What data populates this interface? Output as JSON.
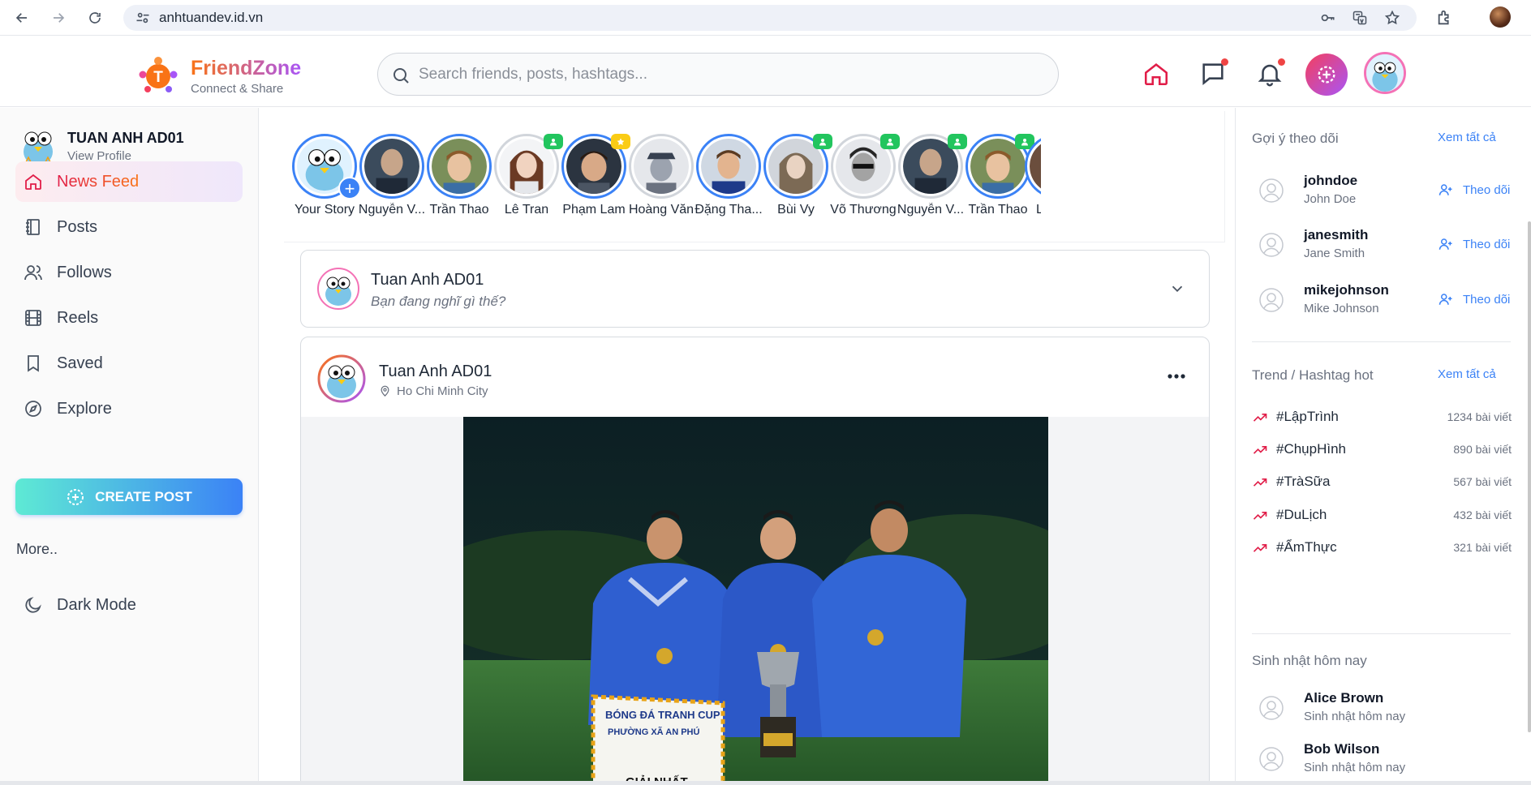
{
  "browser": {
    "url": "anhtuandev.id.vn"
  },
  "header": {
    "brand": "FriendZone",
    "tagline": "Connect & Share",
    "search_placeholder": "Search friends, posts, hashtags..."
  },
  "sidebar": {
    "profile_name": "TUAN ANH AD01",
    "profile_sub": "View Profile",
    "items": [
      {
        "label": "News Feed",
        "icon": "home-icon",
        "active": true
      },
      {
        "label": "Posts",
        "icon": "notebook-icon"
      },
      {
        "label": "Follows",
        "icon": "users-icon"
      },
      {
        "label": "Reels",
        "icon": "film-icon"
      },
      {
        "label": "Saved",
        "icon": "bookmark-icon"
      },
      {
        "label": "Explore",
        "icon": "compass-icon"
      }
    ],
    "create_post": "CREATE POST",
    "more": "More..",
    "dark_mode": "Dark Mode"
  },
  "stories": [
    {
      "name": "Your Story"
    },
    {
      "name": "Nguyễn V..."
    },
    {
      "name": "Trần Thao"
    },
    {
      "name": "Lê Tran"
    },
    {
      "name": "Phạm Lam"
    },
    {
      "name": "Hoàng Văn"
    },
    {
      "name": "Đặng Tha..."
    },
    {
      "name": "Bùi Vy"
    },
    {
      "name": "Võ Thương"
    },
    {
      "name": "Nguyễn V..."
    },
    {
      "name": "Trần Thao"
    },
    {
      "name": "L"
    }
  ],
  "composer": {
    "name": "Tuan Anh AD01",
    "hint": "Bạn đang nghĩ gì thế?"
  },
  "post": {
    "author": "Tuan Anh AD01",
    "location": "Ho Chi Minh City",
    "banner_text": "BÓNG ĐÁ TRANH CUP",
    "banner_text2": "PHƯỜNG XÃ AN PHÚ",
    "banner_text3": "GIẢI NHẤT"
  },
  "right": {
    "suggest_title": "Gợi ý theo dõi",
    "see_all": "Xem tất cả",
    "follow_label": "Theo dõi",
    "suggestions": [
      {
        "username": "johndoe",
        "fullname": "John Doe"
      },
      {
        "username": "janesmith",
        "fullname": "Jane Smith"
      },
      {
        "username": "mikejohnson",
        "fullname": "Mike Johnson"
      }
    ],
    "trend_title": "Trend / Hashtag hot",
    "trend_see_all": "Xem tất cả",
    "hashtags": [
      {
        "tag": "#LậpTrình",
        "count": "1234 bài viết"
      },
      {
        "tag": "#ChụpHình",
        "count": "890 bài viết"
      },
      {
        "tag": "#TràSữa",
        "count": "567 bài viết"
      },
      {
        "tag": "#DuLịch",
        "count": "432 bài viết"
      },
      {
        "tag": "#ẨmThực",
        "count": "321 bài viết"
      }
    ],
    "birthday_title": "Sinh nhật hôm nay",
    "birthdays": [
      {
        "name": "Alice Brown",
        "note": "Sinh nhật hôm nay"
      },
      {
        "name": "Bob Wilson",
        "note": "Sinh nhật hôm nay"
      }
    ]
  },
  "colors": {
    "accent": "#3b82f6",
    "brand_start": "#f97316",
    "brand_end": "#a855f7",
    "active": "#e11d48",
    "online_badge": "#22c55e"
  }
}
